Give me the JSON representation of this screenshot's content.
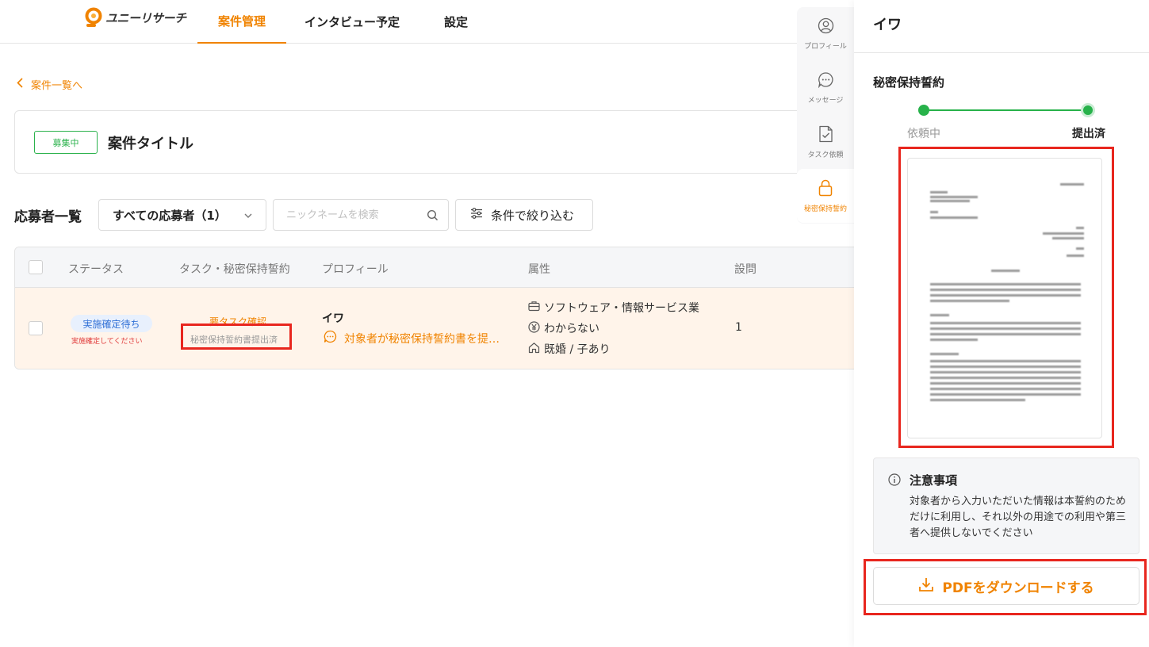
{
  "header": {
    "logo_text": "ユニーリサーチ",
    "tabs": [
      {
        "label": "案件管理",
        "active": true
      },
      {
        "label": "インタビュー予定",
        "active": false
      },
      {
        "label": "設定",
        "active": false
      }
    ]
  },
  "back_link": "案件一覧へ",
  "project": {
    "badge": "募集中",
    "title": "案件タイトル"
  },
  "applicants": {
    "section_title": "応募者一覧",
    "filter_select": "すべての応募者（1）",
    "search_placeholder": "ニックネームを検索",
    "filter_button": "条件で絞り込む",
    "columns": [
      "ステータス",
      "タスク・秘密保持誓約",
      "プロフィール",
      "属性",
      "設問"
    ],
    "rows": [
      {
        "status": "実施確定待ち",
        "status_sub": "実施確定してください",
        "task": "要タスク確認",
        "nda": "秘密保持誓約書提出済",
        "name": "イワ",
        "message": "対象者が秘密保持誓約書を提…",
        "attributes": [
          {
            "icon": "briefcase-icon",
            "text": "ソフトウェア・情報サービス業"
          },
          {
            "icon": "yen-icon",
            "text": "わからない"
          },
          {
            "icon": "home-icon",
            "text": "既婚 / 子あり"
          }
        ],
        "questions": "1"
      }
    ]
  },
  "rail": {
    "items": [
      {
        "icon": "person-icon",
        "label": "プロフィール",
        "active": false
      },
      {
        "icon": "message-icon",
        "label": "メッセージ",
        "active": false
      },
      {
        "icon": "task-icon",
        "label": "タスク依頼",
        "active": false
      },
      {
        "icon": "lock-icon",
        "label": "秘密保持誓約",
        "active": true
      }
    ]
  },
  "panel": {
    "title": "イワ",
    "nda_heading": "秘密保持誓約",
    "steps": [
      {
        "label": "依頼中",
        "done": true
      },
      {
        "label": "提出済",
        "done": true,
        "current": true
      }
    ],
    "notice_title": "注意事項",
    "notice_body": "対象者から入力いただいた情報は本誓約のためだけに利用し、それ以外の用途での利用や第三者へ提供しないでください",
    "download_button": "PDFをダウンロードする"
  },
  "colors": {
    "accent": "#f08300",
    "success": "#27b24a",
    "highlight": "#e8261e",
    "row_highlight": "#fff4ea"
  }
}
